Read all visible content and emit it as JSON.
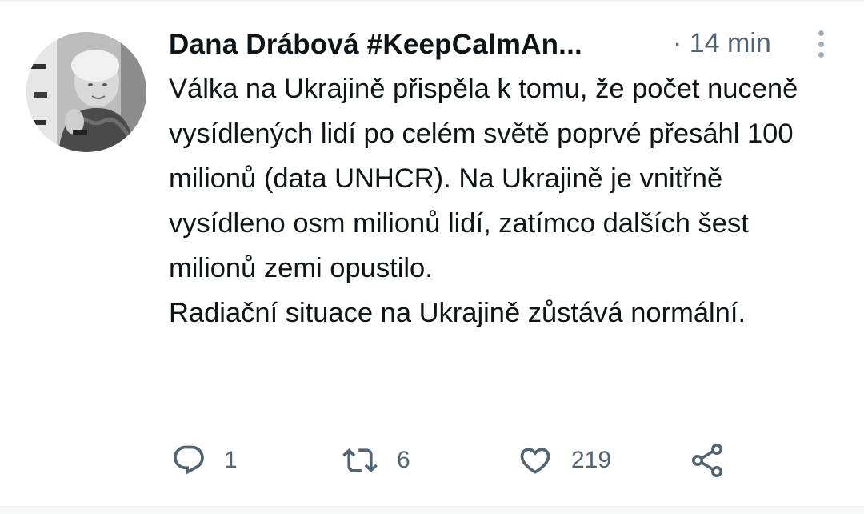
{
  "author": {
    "display_name": "Dana Drábová #KeepCalmAn...",
    "avatar_icon": "profile-photo"
  },
  "timestamp": "· 14 min",
  "tweet": {
    "paragraphs": [
      "Válka na Ukrajině přispěla k tomu, že počet nuceně vysídlených lidí po celém světě poprvé přesáhl 100 milionů (data UNHCR). Na Ukrajině je vnitřně vysídleno osm milionů lidí, zatímco dalších šest milionů zemi opustilo.",
      "Radiační situace na Ukrajině zůstává normální."
    ]
  },
  "actions": {
    "reply_count": "1",
    "retweet_count": "6",
    "like_count": "219",
    "icons": [
      "reply-icon",
      "retweet-icon",
      "like-icon",
      "share-icon"
    ]
  },
  "colors": {
    "text": "#0f1419",
    "secondary": "#536471",
    "icon": "#536471"
  }
}
